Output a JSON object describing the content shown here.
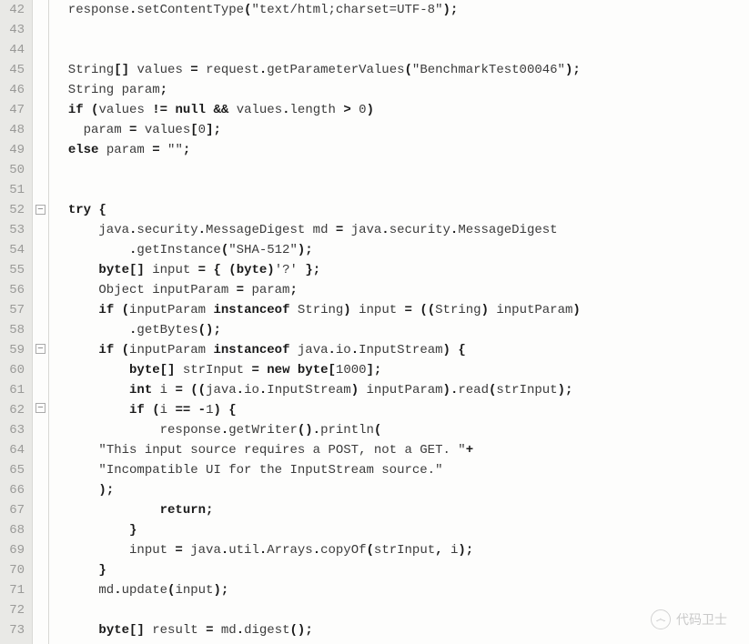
{
  "lines": [
    {
      "num": 42,
      "fold": "",
      "tokens": [
        [
          "",
          "  response"
        ],
        [
          "op",
          "."
        ],
        [
          "",
          "setContentType"
        ],
        [
          "op",
          "("
        ],
        [
          "str",
          "\"text/html;charset=UTF-8\""
        ],
        [
          "op",
          ");"
        ]
      ]
    },
    {
      "num": 43,
      "fold": "",
      "tokens": []
    },
    {
      "num": 44,
      "fold": "",
      "tokens": []
    },
    {
      "num": 45,
      "fold": "",
      "tokens": [
        [
          "",
          "  String"
        ],
        [
          "op",
          "[] "
        ],
        [
          "",
          "values "
        ],
        [
          "op",
          "= "
        ],
        [
          "",
          "request"
        ],
        [
          "op",
          "."
        ],
        [
          "",
          "getParameterValues"
        ],
        [
          "op",
          "("
        ],
        [
          "str",
          "\"BenchmarkTest00046\""
        ],
        [
          "op",
          ");"
        ]
      ]
    },
    {
      "num": 46,
      "fold": "",
      "tokens": [
        [
          "",
          "  String param"
        ],
        [
          "op",
          ";"
        ]
      ]
    },
    {
      "num": 47,
      "fold": "",
      "tokens": [
        [
          "",
          "  "
        ],
        [
          "kw",
          "if"
        ],
        [
          "",
          " "
        ],
        [
          "op",
          "("
        ],
        [
          "",
          "values "
        ],
        [
          "op",
          "!= "
        ],
        [
          "kw",
          "null"
        ],
        [
          "",
          " "
        ],
        [
          "op",
          "&& "
        ],
        [
          "",
          "values"
        ],
        [
          "op",
          "."
        ],
        [
          "",
          "length "
        ],
        [
          "op",
          "> "
        ],
        [
          "num",
          "0"
        ],
        [
          "op",
          ")"
        ]
      ]
    },
    {
      "num": 48,
      "fold": "",
      "tokens": [
        [
          "",
          "    param "
        ],
        [
          "op",
          "= "
        ],
        [
          "",
          "values"
        ],
        [
          "op",
          "["
        ],
        [
          "num",
          "0"
        ],
        [
          "op",
          "];"
        ]
      ]
    },
    {
      "num": 49,
      "fold": "",
      "tokens": [
        [
          "",
          "  "
        ],
        [
          "kw",
          "else"
        ],
        [
          "",
          " param "
        ],
        [
          "op",
          "= "
        ],
        [
          "str",
          "\"\""
        ],
        [
          "op",
          ";"
        ]
      ]
    },
    {
      "num": 50,
      "fold": "",
      "tokens": []
    },
    {
      "num": 51,
      "fold": "",
      "tokens": []
    },
    {
      "num": 52,
      "fold": "box",
      "tokens": [
        [
          "",
          "  "
        ],
        [
          "kw",
          "try"
        ],
        [
          "",
          " "
        ],
        [
          "op",
          "{"
        ]
      ]
    },
    {
      "num": 53,
      "fold": "",
      "tokens": [
        [
          "",
          "      java"
        ],
        [
          "op",
          "."
        ],
        [
          "",
          "security"
        ],
        [
          "op",
          "."
        ],
        [
          "",
          "MessageDigest md "
        ],
        [
          "op",
          "= "
        ],
        [
          "",
          "java"
        ],
        [
          "op",
          "."
        ],
        [
          "",
          "security"
        ],
        [
          "op",
          "."
        ],
        [
          "",
          "MessageDigest"
        ]
      ]
    },
    {
      "num": 54,
      "fold": "",
      "tokens": [
        [
          "",
          "          "
        ],
        [
          "op",
          "."
        ],
        [
          "",
          "getInstance"
        ],
        [
          "op",
          "("
        ],
        [
          "str",
          "\"SHA-512\""
        ],
        [
          "op",
          ");"
        ]
      ]
    },
    {
      "num": 55,
      "fold": "",
      "tokens": [
        [
          "",
          "      "
        ],
        [
          "kw",
          "byte"
        ],
        [
          "op",
          "[] "
        ],
        [
          "",
          "input "
        ],
        [
          "op",
          "= { ("
        ],
        [
          "kw",
          "byte"
        ],
        [
          "op",
          ")"
        ],
        [
          "str",
          "'?'"
        ],
        [
          "",
          " "
        ],
        [
          "op",
          "};"
        ]
      ]
    },
    {
      "num": 56,
      "fold": "",
      "tokens": [
        [
          "",
          "      Object inputParam "
        ],
        [
          "op",
          "= "
        ],
        [
          "",
          "param"
        ],
        [
          "op",
          ";"
        ]
      ]
    },
    {
      "num": 57,
      "fold": "",
      "tokens": [
        [
          "",
          "      "
        ],
        [
          "kw",
          "if"
        ],
        [
          "",
          " "
        ],
        [
          "op",
          "("
        ],
        [
          "",
          "inputParam "
        ],
        [
          "kw",
          "instanceof"
        ],
        [
          "",
          " String"
        ],
        [
          "op",
          ") "
        ],
        [
          "",
          "input "
        ],
        [
          "op",
          "= (("
        ],
        [
          "",
          "String"
        ],
        [
          "op",
          ") "
        ],
        [
          "",
          "inputParam"
        ],
        [
          "op",
          ")"
        ]
      ]
    },
    {
      "num": 58,
      "fold": "",
      "tokens": [
        [
          "",
          "          "
        ],
        [
          "op",
          "."
        ],
        [
          "",
          "getBytes"
        ],
        [
          "op",
          "();"
        ]
      ]
    },
    {
      "num": 59,
      "fold": "box",
      "tokens": [
        [
          "",
          "      "
        ],
        [
          "kw",
          "if"
        ],
        [
          "",
          " "
        ],
        [
          "op",
          "("
        ],
        [
          "",
          "inputParam "
        ],
        [
          "kw",
          "instanceof"
        ],
        [
          "",
          " java"
        ],
        [
          "op",
          "."
        ],
        [
          "",
          "io"
        ],
        [
          "op",
          "."
        ],
        [
          "",
          "InputStream"
        ],
        [
          "op",
          ") {"
        ]
      ]
    },
    {
      "num": 60,
      "fold": "",
      "tokens": [
        [
          "",
          "          "
        ],
        [
          "kw",
          "byte"
        ],
        [
          "op",
          "[] "
        ],
        [
          "",
          "strInput "
        ],
        [
          "op",
          "= "
        ],
        [
          "kw",
          "new"
        ],
        [
          "",
          " "
        ],
        [
          "kw",
          "byte"
        ],
        [
          "op",
          "["
        ],
        [
          "num",
          "1000"
        ],
        [
          "op",
          "];"
        ]
      ]
    },
    {
      "num": 61,
      "fold": "",
      "tokens": [
        [
          "",
          "          "
        ],
        [
          "kw",
          "int"
        ],
        [
          "",
          " i "
        ],
        [
          "op",
          "= (("
        ],
        [
          "",
          "java"
        ],
        [
          "op",
          "."
        ],
        [
          "",
          "io"
        ],
        [
          "op",
          "."
        ],
        [
          "",
          "InputStream"
        ],
        [
          "op",
          ") "
        ],
        [
          "",
          "inputParam"
        ],
        [
          "op",
          ")."
        ],
        [
          "",
          "read"
        ],
        [
          "op",
          "("
        ],
        [
          "",
          "strInput"
        ],
        [
          "op",
          ");"
        ]
      ]
    },
    {
      "num": 62,
      "fold": "box",
      "tokens": [
        [
          "",
          "          "
        ],
        [
          "kw",
          "if"
        ],
        [
          "",
          " "
        ],
        [
          "op",
          "("
        ],
        [
          "",
          "i "
        ],
        [
          "op",
          "== -"
        ],
        [
          "num",
          "1"
        ],
        [
          "op",
          ") {"
        ]
      ]
    },
    {
      "num": 63,
      "fold": "",
      "tokens": [
        [
          "",
          "              response"
        ],
        [
          "op",
          "."
        ],
        [
          "",
          "getWriter"
        ],
        [
          "op",
          "()."
        ],
        [
          "",
          "println"
        ],
        [
          "op",
          "("
        ]
      ]
    },
    {
      "num": 64,
      "fold": "",
      "tokens": [
        [
          "",
          "      "
        ],
        [
          "str",
          "\"This input source requires a POST, not a GET. \""
        ],
        [
          "op",
          "+"
        ]
      ]
    },
    {
      "num": 65,
      "fold": "",
      "tokens": [
        [
          "",
          "      "
        ],
        [
          "str",
          "\"Incompatible UI for the InputStream source.\""
        ]
      ]
    },
    {
      "num": 66,
      "fold": "",
      "tokens": [
        [
          "",
          "      "
        ],
        [
          "op",
          ");"
        ]
      ]
    },
    {
      "num": 67,
      "fold": "",
      "tokens": [
        [
          "",
          "              "
        ],
        [
          "kw",
          "return"
        ],
        [
          "op",
          ";"
        ]
      ]
    },
    {
      "num": 68,
      "fold": "",
      "tokens": [
        [
          "",
          "          "
        ],
        [
          "op",
          "}"
        ]
      ]
    },
    {
      "num": 69,
      "fold": "",
      "tokens": [
        [
          "",
          "          input "
        ],
        [
          "op",
          "= "
        ],
        [
          "",
          "java"
        ],
        [
          "op",
          "."
        ],
        [
          "",
          "util"
        ],
        [
          "op",
          "."
        ],
        [
          "",
          "Arrays"
        ],
        [
          "op",
          "."
        ],
        [
          "",
          "copyOf"
        ],
        [
          "op",
          "("
        ],
        [
          "",
          "strInput"
        ],
        [
          "op",
          ", "
        ],
        [
          "",
          "i"
        ],
        [
          "op",
          ");"
        ]
      ]
    },
    {
      "num": 70,
      "fold": "",
      "tokens": [
        [
          "",
          "      "
        ],
        [
          "op",
          "}"
        ]
      ]
    },
    {
      "num": 71,
      "fold": "",
      "tokens": [
        [
          "",
          "      md"
        ],
        [
          "op",
          "."
        ],
        [
          "",
          "update"
        ],
        [
          "op",
          "("
        ],
        [
          "",
          "input"
        ],
        [
          "op",
          ");"
        ]
      ]
    },
    {
      "num": 72,
      "fold": "",
      "tokens": []
    },
    {
      "num": 73,
      "fold": "",
      "tokens": [
        [
          "",
          "      "
        ],
        [
          "kw",
          "byte"
        ],
        [
          "op",
          "[] "
        ],
        [
          "",
          "result "
        ],
        [
          "op",
          "= "
        ],
        [
          "",
          "md"
        ],
        [
          "op",
          "."
        ],
        [
          "",
          "digest"
        ],
        [
          "op",
          "();"
        ]
      ]
    }
  ],
  "watermark": {
    "icon_glyph": "෴",
    "text": "代码卫士"
  }
}
